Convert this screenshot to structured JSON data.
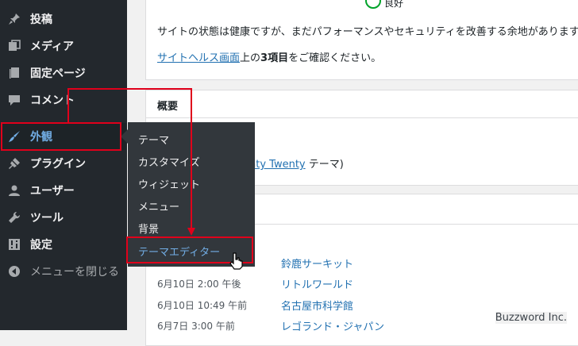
{
  "sidebar": {
    "items": [
      {
        "label": "投稿",
        "icon": "pin-icon"
      },
      {
        "label": "メディア",
        "icon": "media-icon"
      },
      {
        "label": "固定ページ",
        "icon": "page-icon"
      },
      {
        "label": "コメント",
        "icon": "comment-icon"
      },
      {
        "label": "外観",
        "icon": "brush-icon"
      },
      {
        "label": "プラグイン",
        "icon": "plugin-icon"
      },
      {
        "label": "ユーザー",
        "icon": "user-icon"
      },
      {
        "label": "ツール",
        "icon": "wrench-icon"
      },
      {
        "label": "設定",
        "icon": "settings-icon"
      },
      {
        "label": "メニューを閉じる",
        "icon": "collapse-icon"
      }
    ]
  },
  "submenu": {
    "items": [
      "テーマ",
      "カスタマイズ",
      "ウィジェット",
      "メニュー",
      "背景",
      "テーマエディター"
    ]
  },
  "health": {
    "status": "良好",
    "message": "サイトの状態は健康ですが、まだパフォーマンスやセキュリティを改善する余地があります。",
    "link_text": "サイトヘルス画面",
    "suffix_before": "上の",
    "count_text": "3項目",
    "suffix_after": "をご確認ください。"
  },
  "overview": {
    "title": "概要",
    "theme_link": "nty Twenty",
    "theme_suffix": "テーマ)"
  },
  "pending": {
    "rows": [
      {
        "date": "",
        "title": "鈴鹿サーキット"
      },
      {
        "date": "6月10日 2:00 午後",
        "title": "リトルワールド"
      },
      {
        "date": "6月10日 10:49 午前",
        "title": "名古屋市科学館"
      },
      {
        "date": "6月7日 3:00 午前",
        "title": "レゴランド・ジャパン"
      }
    ]
  },
  "watermark": "Buzzword Inc.",
  "colors": {
    "sidebar_bg": "#23282d",
    "submenu_bg": "#32373c",
    "accent": "#72aee6",
    "link": "#2271b1",
    "annotation": "#e0001b",
    "health_good": "#00a32a"
  }
}
